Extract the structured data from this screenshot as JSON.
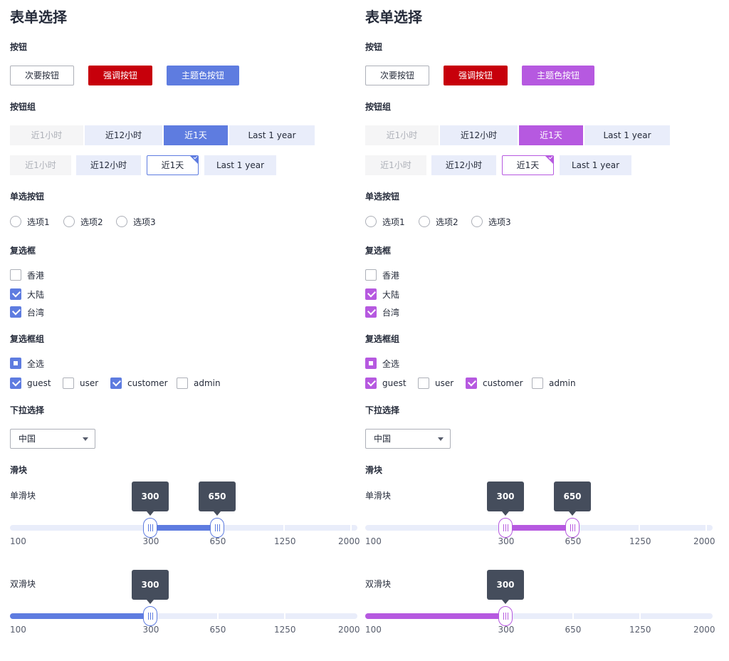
{
  "panels": [
    {
      "theme": "default-blue",
      "accent": "#5e7ce0",
      "title": "表单选择",
      "sections": {
        "buttons": "按钮",
        "button_group": "按钮组",
        "radio": "单选按钮",
        "checkbox": "复选框",
        "checkbox_group": "复选框组",
        "select": "下拉选择",
        "slider": "滑块"
      },
      "buttons": {
        "secondary": "次要按钮",
        "danger": "强调按钮",
        "primary": "主题色按钮"
      },
      "button_group": {
        "options": [
          "近1小时",
          "近12小时",
          "近1天",
          "Last 1 year"
        ],
        "selected": "近1天",
        "disabled": "近1小时"
      },
      "radios": [
        "选项1",
        "选项2",
        "选项3"
      ],
      "checkboxes": [
        {
          "label": "香港",
          "checked": false
        },
        {
          "label": "大陆",
          "checked": true
        },
        {
          "label": "台湾",
          "checked": true
        }
      ],
      "checkbox_group": {
        "select_all": "全选",
        "items": [
          {
            "label": "guest",
            "checked": true
          },
          {
            "label": "user",
            "checked": false
          },
          {
            "label": "customer",
            "checked": true
          },
          {
            "label": "admin",
            "checked": false
          }
        ]
      },
      "select": {
        "value": "中国"
      },
      "slider": {
        "ticks": [
          "100",
          "300",
          "650",
          "1250",
          "2000"
        ],
        "range_label": "单滑块",
        "range_values": [
          "300",
          "650"
        ],
        "single_label": "双滑块",
        "single_value": "300"
      }
    },
    {
      "theme": "purple",
      "accent": "#b659e0",
      "title": "表单选择",
      "sections": {
        "buttons": "按钮",
        "button_group": "按钮组",
        "radio": "单选按钮",
        "checkbox": "复选框",
        "checkbox_group": "复选框组",
        "select": "下拉选择",
        "slider": "滑块"
      },
      "buttons": {
        "secondary": "次要按钮",
        "danger": "强调按钮",
        "primary": "主题色按钮"
      },
      "button_group": {
        "options": [
          "近1小时",
          "近12小时",
          "近1天",
          "Last 1 year"
        ],
        "selected": "近1天",
        "disabled": "近1小时"
      },
      "radios": [
        "选项1",
        "选项2",
        "选项3"
      ],
      "checkboxes": [
        {
          "label": "香港",
          "checked": false
        },
        {
          "label": "大陆",
          "checked": true
        },
        {
          "label": "台湾",
          "checked": true
        }
      ],
      "checkbox_group": {
        "select_all": "全选",
        "items": [
          {
            "label": "guest",
            "checked": true
          },
          {
            "label": "user",
            "checked": false
          },
          {
            "label": "customer",
            "checked": true
          },
          {
            "label": "admin",
            "checked": false
          }
        ]
      },
      "select": {
        "value": "中国"
      },
      "slider": {
        "ticks": [
          "100",
          "300",
          "650",
          "1250",
          "2000"
        ],
        "range_label": "单滑块",
        "range_values": [
          "300",
          "650"
        ],
        "single_label": "双滑块",
        "single_value": "300"
      }
    }
  ]
}
